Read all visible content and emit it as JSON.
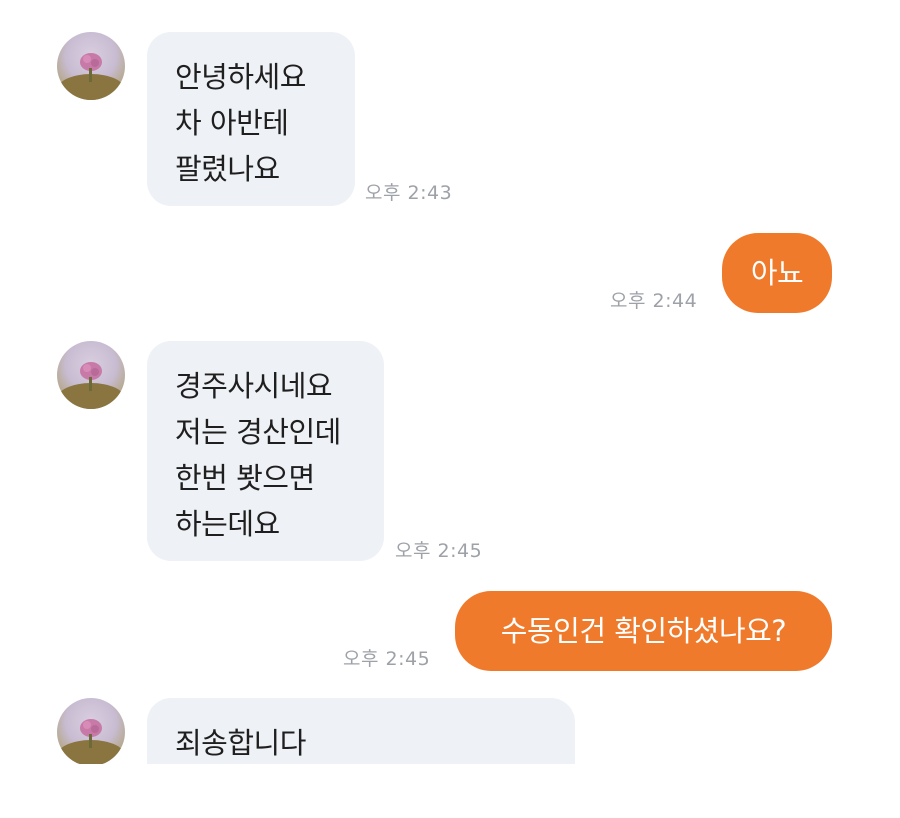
{
  "messages": [
    {
      "direction": "incoming",
      "lines": [
        "안녕하세요",
        "차 아반테",
        "팔렸나요"
      ],
      "time": "오후 2:43"
    },
    {
      "direction": "outgoing",
      "lines": [
        "아뇨"
      ],
      "time": "오후 2:44"
    },
    {
      "direction": "incoming",
      "lines": [
        "경주사시네요",
        "저는 경산인데",
        "한번 봣으면",
        "하는데요"
      ],
      "time": "오후 2:45"
    },
    {
      "direction": "outgoing",
      "lines": [
        "수동인건 확인하셨나요?"
      ],
      "time": "오후 2:45"
    },
    {
      "direction": "incoming",
      "lines": [
        "죄송합니다"
      ],
      "time": ""
    }
  ],
  "colors": {
    "outgoing_bubble": "#f07a2b",
    "incoming_bubble": "#eef1f5",
    "timestamp": "#9ea2a8"
  },
  "icons": {
    "avatar": "profile-photo-avatar"
  }
}
